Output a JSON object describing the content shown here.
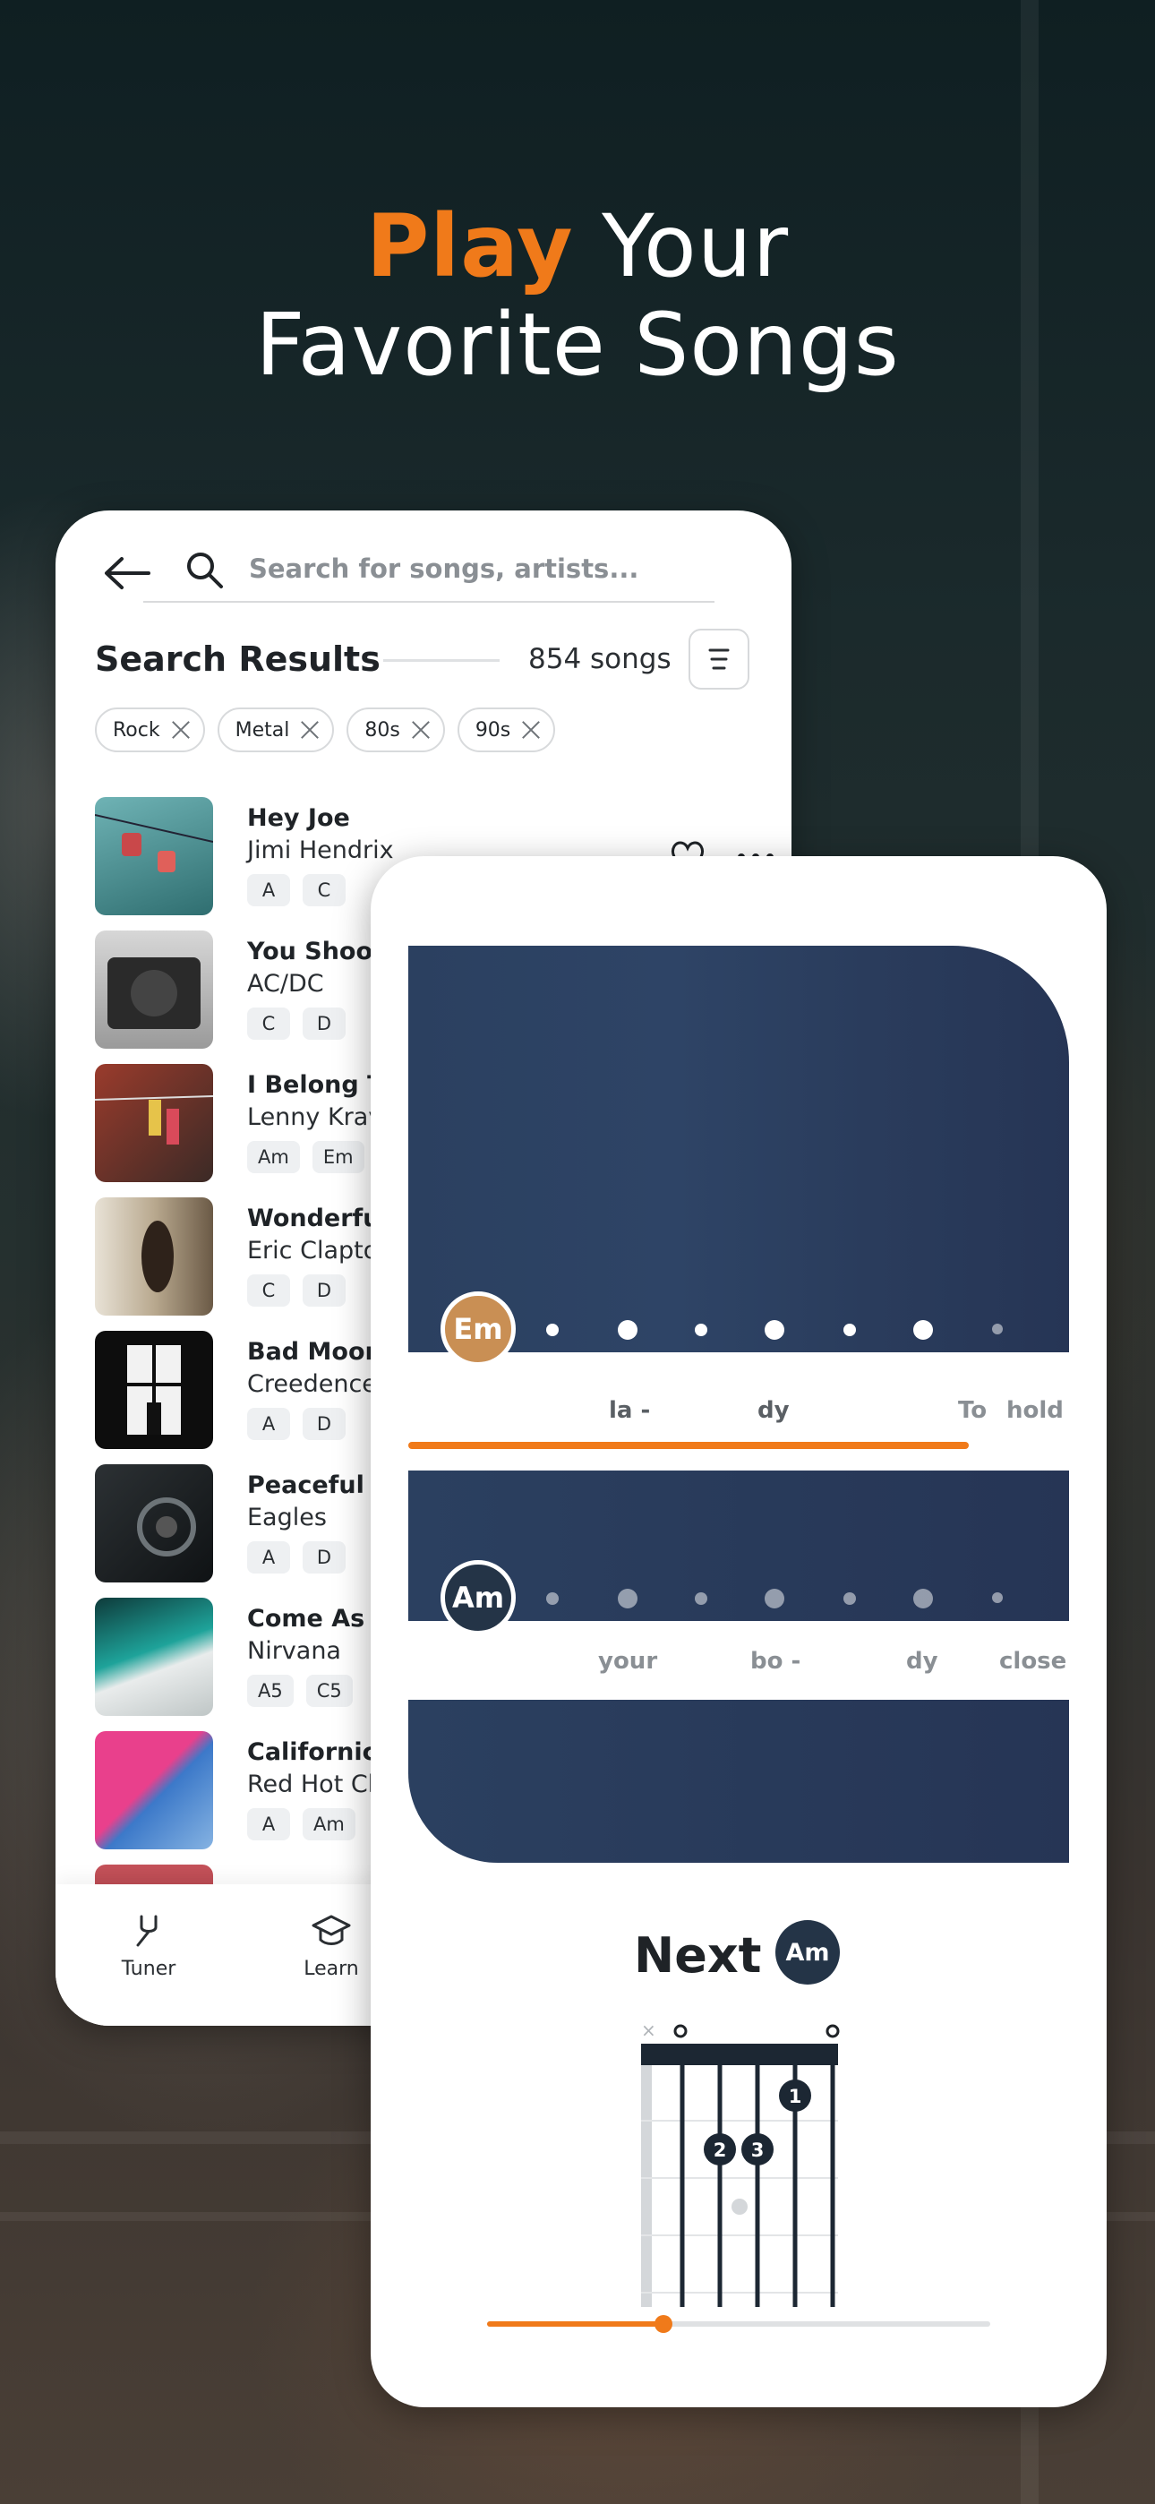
{
  "headline": {
    "accent": "Play",
    "line1_rest": " Your",
    "line2": "Favorite Songs"
  },
  "colors": {
    "accent": "#f07a1a",
    "panel": "#2b4060",
    "badge_em": "#c98f54",
    "badge_am": "#243447"
  },
  "search": {
    "placeholder": "Search for songs, artists..."
  },
  "results": {
    "title": "Search Results",
    "count": "854 songs"
  },
  "filters": [
    "Rock",
    "Metal",
    "80s",
    "90s"
  ],
  "songs": [
    {
      "title": "Hey Joe",
      "artist": "Jimi Hendrix",
      "chords": [
        "A",
        "C"
      ]
    },
    {
      "title": "You Shook",
      "artist": "AC/DC",
      "chords": [
        "C",
        "D"
      ]
    },
    {
      "title": "I Belong To",
      "artist": "Lenny Kravi",
      "chords": [
        "Am",
        "Em"
      ]
    },
    {
      "title": "Wonderful",
      "artist": "Eric Clapton",
      "chords": [
        "C",
        "D"
      ]
    },
    {
      "title": "Bad Moon",
      "artist": "Creedence C",
      "chords": [
        "A",
        "D"
      ]
    },
    {
      "title": "Peaceful Ea",
      "artist": "Eagles",
      "chords": [
        "A",
        "D"
      ]
    },
    {
      "title": "Come As Yo",
      "artist": "Nirvana",
      "chords": [
        "A5",
        "C5"
      ]
    },
    {
      "title": "Californica",
      "artist": "Red Hot Chi",
      "chords": [
        "A",
        "Am"
      ]
    }
  ],
  "nav": {
    "tuner": "Tuner",
    "learn": "Learn"
  },
  "player": {
    "current_chord": "Em",
    "lyrics_line1": [
      "la -",
      "dy",
      "To",
      "hold"
    ],
    "second_chord": "Am",
    "lyrics_line2": [
      "your",
      "bo -",
      "dy",
      "close"
    ],
    "next_label": "Next",
    "next_chord": "Am",
    "fingers": [
      "1",
      "2",
      "3"
    ],
    "song_progress": 0.35
  }
}
